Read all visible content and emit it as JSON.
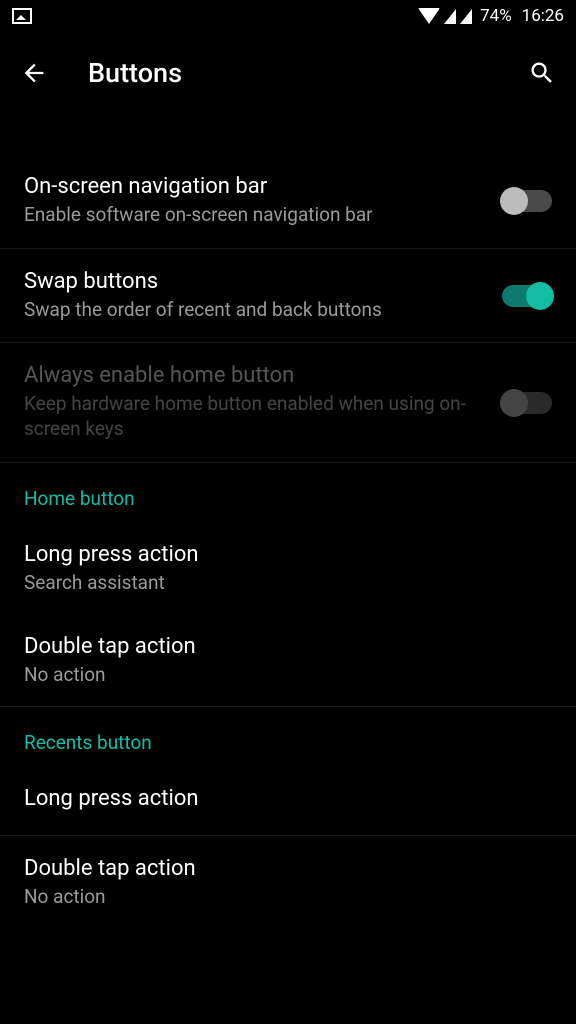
{
  "status": {
    "battery": "74%",
    "time": "16:26"
  },
  "header": {
    "title": "Buttons"
  },
  "settings": {
    "onscreen_nav": {
      "title": "On-screen navigation bar",
      "subtitle": "Enable software on-screen navigation bar",
      "enabled": false
    },
    "swap_buttons": {
      "title": "Swap buttons",
      "subtitle": "Swap the order of recent and back buttons",
      "enabled": true
    },
    "always_home": {
      "title": "Always enable home button",
      "subtitle": "Keep hardware home button enabled when using on-screen keys",
      "enabled": false,
      "disabled": true
    }
  },
  "sections": {
    "home": {
      "header": "Home button",
      "long_press": {
        "title": "Long press action",
        "value": "Search assistant"
      },
      "double_tap": {
        "title": "Double tap action",
        "value": "No action"
      }
    },
    "recents": {
      "header": "Recents button",
      "long_press": {
        "title": "Long press action"
      },
      "double_tap": {
        "title": "Double tap action",
        "value": "No action"
      }
    }
  }
}
